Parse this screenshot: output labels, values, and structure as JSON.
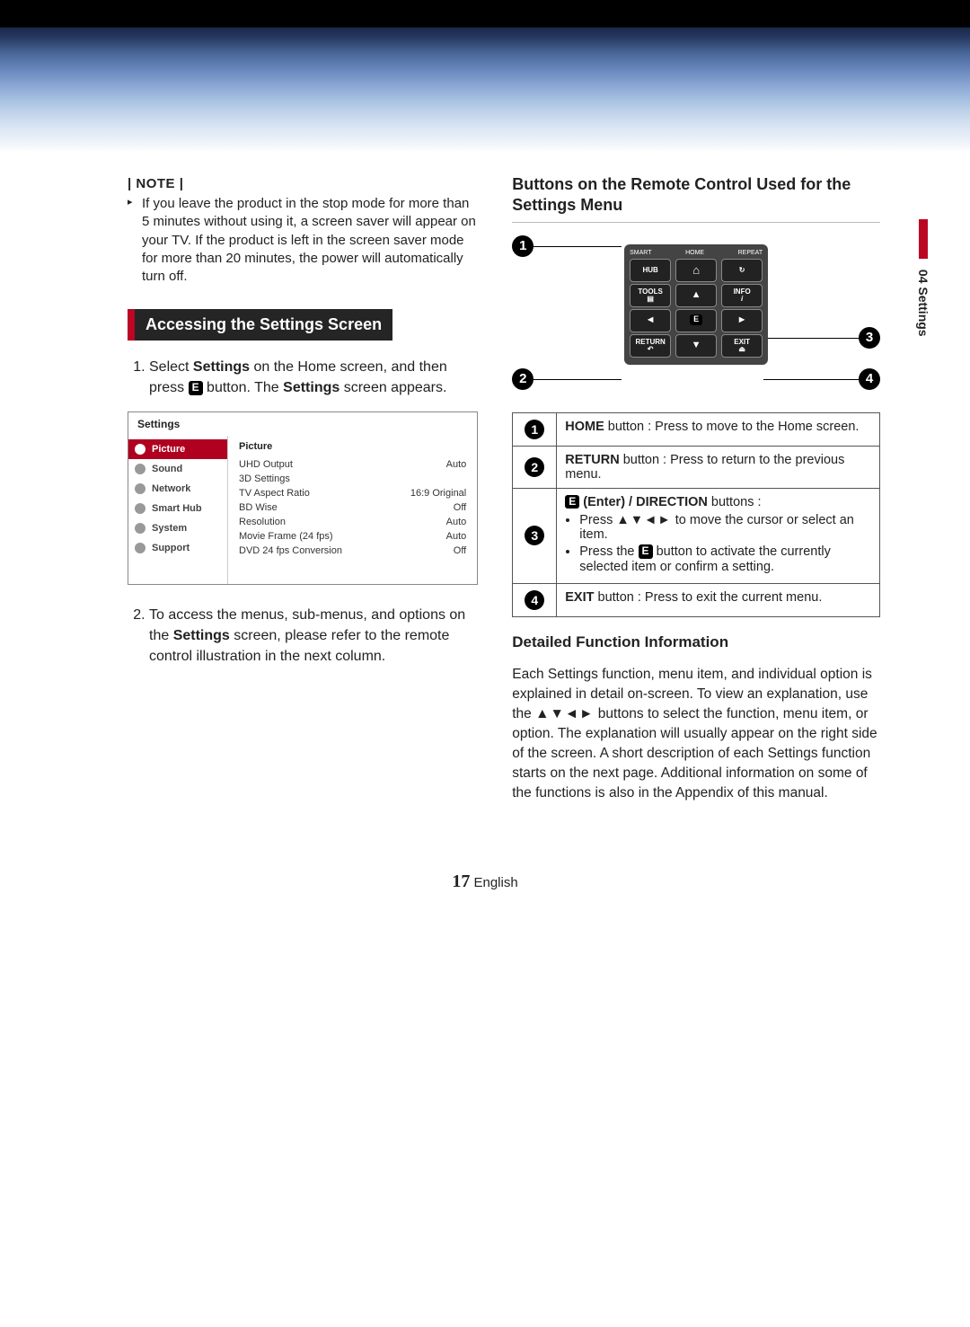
{
  "side_tab": "04  Settings",
  "left": {
    "note_label": "| NOTE |",
    "note_text": "If you leave the product in the stop mode for more than 5 minutes without using it, a screen saver will appear on your TV. If the product is left in the screen saver mode for more than 20 minutes, the power will automatically turn off.",
    "section_heading": "Accessing the Settings Screen",
    "step1_pre": "Select ",
    "step1_bold1": "Settings",
    "step1_mid": " on the Home screen, and then press ",
    "step1_post": " button. The ",
    "step1_bold2": "Settings",
    "step1_tail": " screen appears.",
    "step2_pre": "To access the menus, sub-menus, and options on the ",
    "step2_bold": "Settings",
    "step2_post": " screen, please refer to the remote control illustration in the next column."
  },
  "settings_panel": {
    "title": "Settings",
    "sidebar": [
      "Picture",
      "Sound",
      "Network",
      "Smart Hub",
      "System",
      "Support"
    ],
    "main_header": "Picture",
    "rows": [
      {
        "k": "UHD Output",
        "v": "Auto"
      },
      {
        "k": "3D Settings",
        "v": ""
      },
      {
        "k": "TV Aspect Ratio",
        "v": "16:9 Original"
      },
      {
        "k": "BD Wise",
        "v": "Off"
      },
      {
        "k": "Resolution",
        "v": "Auto"
      },
      {
        "k": "Movie Frame (24 fps)",
        "v": "Auto"
      },
      {
        "k": "DVD 24 fps Conversion",
        "v": "Off"
      }
    ]
  },
  "right": {
    "subhead": "Buttons on the Remote Control Used for the Settings Menu",
    "remote": {
      "top": [
        "SMART",
        "HOME",
        "REPEAT"
      ],
      "hub": "HUB",
      "tools": "TOOLS",
      "info": "INFO",
      "return": "RETURN",
      "exit": "EXIT"
    },
    "legend": {
      "n1_bold": "HOME",
      "n1_rest": " button : Press to move to the Home screen.",
      "n2_bold": "RETURN",
      "n2_rest": " button : Press to return to the previous menu.",
      "n3_label": "(Enter) / DIRECTION",
      "n3_after": " buttons :",
      "n3_b1_pre": "Press ",
      "n3_b1_post": " to move the cursor or select an item.",
      "n3_b2_pre": "Press the ",
      "n3_b2_post": " button to activate the currently selected item or confirm a setting.",
      "n4_bold": "EXIT",
      "n4_rest": " button : Press to exit the current menu."
    },
    "dfi_head": "Detailed Function Information",
    "dfi_body_pre": "Each Settings function, menu item, and individual option is explained in detail on-screen. To view an explanation, use the ",
    "dfi_body_post": " buttons to select the function, menu item, or option. The explanation will usually appear on the right side of the screen. A short description of each Settings function starts on the next page. Additional information on some of the functions is also in the Appendix of this manual."
  },
  "footer": {
    "page": "17",
    "lang": "English"
  },
  "glyphs": {
    "enter": "E",
    "arrows": "▲▼◄►"
  }
}
